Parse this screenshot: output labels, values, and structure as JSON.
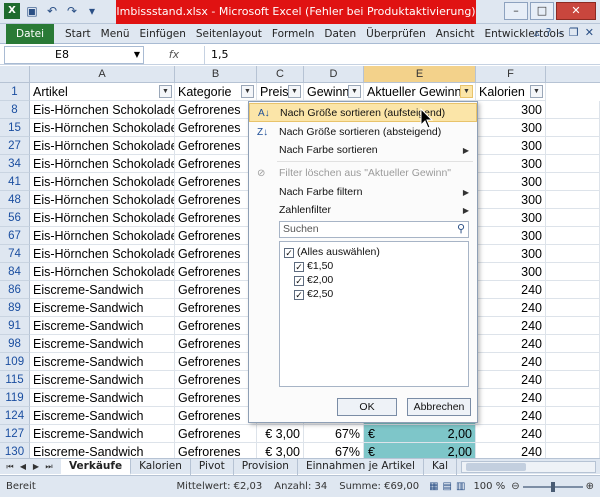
{
  "window": {
    "title": "Imbissstand.xlsx - Microsoft Excel (Fehler bei Produktaktivierung)",
    "controls": [
      "–",
      "□",
      "✕"
    ]
  },
  "ribbon": {
    "file": "Datei",
    "tabs": [
      "Start",
      "Menü",
      "Einfügen",
      "Seitenlayout",
      "Formeln",
      "Daten",
      "Überprüfen",
      "Ansicht",
      "Entwicklertools"
    ]
  },
  "formula_bar": {
    "name_box": "E8",
    "fx": "fx",
    "value": "1,5"
  },
  "columns": [
    "A",
    "B",
    "C",
    "D",
    "E",
    "F"
  ],
  "headers": {
    "row_number": "1",
    "artikel": "Artikel",
    "kategorie": "Kategorie",
    "preis": "Preis",
    "gewinn": "Gewinn",
    "aktueller_gewinn": "Aktueller Gewinn",
    "kalorien": "Kalorien"
  },
  "rows": [
    {
      "num": "8",
      "artikel": "Eis-Hörnchen Schokolade",
      "kategorie": "Gefrorenes",
      "kalorien": "300"
    },
    {
      "num": "15",
      "artikel": "Eis-Hörnchen Schokolade",
      "kategorie": "Gefrorenes",
      "kalorien": "300"
    },
    {
      "num": "27",
      "artikel": "Eis-Hörnchen Schokolade",
      "kategorie": "Gefrorenes",
      "kalorien": "300"
    },
    {
      "num": "34",
      "artikel": "Eis-Hörnchen Schokolade",
      "kategorie": "Gefrorenes",
      "kalorien": "300"
    },
    {
      "num": "41",
      "artikel": "Eis-Hörnchen Schokolade",
      "kategorie": "Gefrorenes",
      "kalorien": "300"
    },
    {
      "num": "48",
      "artikel": "Eis-Hörnchen Schokolade",
      "kategorie": "Gefrorenes",
      "kalorien": "300"
    },
    {
      "num": "56",
      "artikel": "Eis-Hörnchen Schokolade",
      "kategorie": "Gefrorenes",
      "kalorien": "300"
    },
    {
      "num": "67",
      "artikel": "Eis-Hörnchen Schokolade",
      "kategorie": "Gefrorenes",
      "kalorien": "300"
    },
    {
      "num": "74",
      "artikel": "Eis-Hörnchen Schokolade",
      "kategorie": "Gefrorenes",
      "kalorien": "300"
    },
    {
      "num": "84",
      "artikel": "Eis-Hörnchen Schokolade",
      "kategorie": "Gefrorenes",
      "kalorien": "300"
    },
    {
      "num": "86",
      "artikel": "Eiscreme-Sandwich",
      "kategorie": "Gefrorenes",
      "kalorien": "240"
    },
    {
      "num": "89",
      "artikel": "Eiscreme-Sandwich",
      "kategorie": "Gefrorenes",
      "kalorien": "240"
    },
    {
      "num": "91",
      "artikel": "Eiscreme-Sandwich",
      "kategorie": "Gefrorenes",
      "kalorien": "240"
    },
    {
      "num": "98",
      "artikel": "Eiscreme-Sandwich",
      "kategorie": "Gefrorenes",
      "kalorien": "240"
    },
    {
      "num": "109",
      "artikel": "Eiscreme-Sandwich",
      "kategorie": "Gefrorenes",
      "kalorien": "240"
    },
    {
      "num": "115",
      "artikel": "Eiscreme-Sandwich",
      "kategorie": "Gefrorenes",
      "kalorien": "240"
    },
    {
      "num": "119",
      "artikel": "Eiscreme-Sandwich",
      "kategorie": "Gefrorenes",
      "kalorien": "240"
    },
    {
      "num": "124",
      "artikel": "Eiscreme-Sandwich",
      "kategorie": "Gefrorenes",
      "kalorien": "240"
    },
    {
      "num": "127",
      "artikel": "Eiscreme-Sandwich",
      "kategorie": "Gefrorenes",
      "preis": "€ 3,00",
      "gewinn": "67%",
      "aktueller_gewinn": "2,00",
      "kalorien": "240"
    },
    {
      "num": "130",
      "artikel": "Eiscreme-Sandwich",
      "kategorie": "Gefrorenes",
      "preis": "€ 3,00",
      "gewinn": "67%",
      "aktueller_gewinn": "2,00",
      "kalorien": "240"
    }
  ],
  "currency_marker": "€",
  "filter_menu": {
    "items": [
      "Nach Größe sortieren (aufsteigend)",
      "Nach Größe sortieren (absteigend)",
      "Nach Farbe sortieren",
      "Filter löschen aus \"Aktueller Gewinn\"",
      "Nach Farbe filtern",
      "Zahlenfilter"
    ],
    "search_placeholder": "Suchen",
    "list": [
      "(Alles auswählen)",
      "€1,50",
      "€2,00",
      "€2,50"
    ],
    "ok": "OK",
    "cancel": "Abbrechen"
  },
  "sheet_tabs": [
    "Verkäufe",
    "Kalorien",
    "Pivot",
    "Provision",
    "Einnahmen je Artikel",
    "Kal"
  ],
  "status_bar": {
    "mode": "Bereit",
    "mittelwert": "Mittelwert: €2,03",
    "anzahl": "Anzahl: 34",
    "summe": "Summe: €69,00",
    "zoom": "100 %"
  },
  "colors": {
    "title_red": "#e01212",
    "file_green": "#2a7a36",
    "highlight": "#fbe5a8",
    "teal": "#7ec6c9"
  }
}
